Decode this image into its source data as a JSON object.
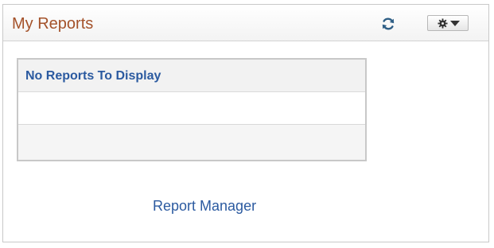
{
  "pagelet": {
    "title": "My Reports",
    "refresh_icon": "refresh-icon",
    "options_icon": "gear-icon",
    "options_caret_icon": "chevron-down-icon"
  },
  "grid": {
    "header": "No Reports To Display",
    "rows": [
      "",
      ""
    ]
  },
  "footer": {
    "link_label": "Report Manager"
  },
  "colors": {
    "title": "#a4522a",
    "link": "#2b5aa0",
    "border": "#c8c8c8"
  }
}
